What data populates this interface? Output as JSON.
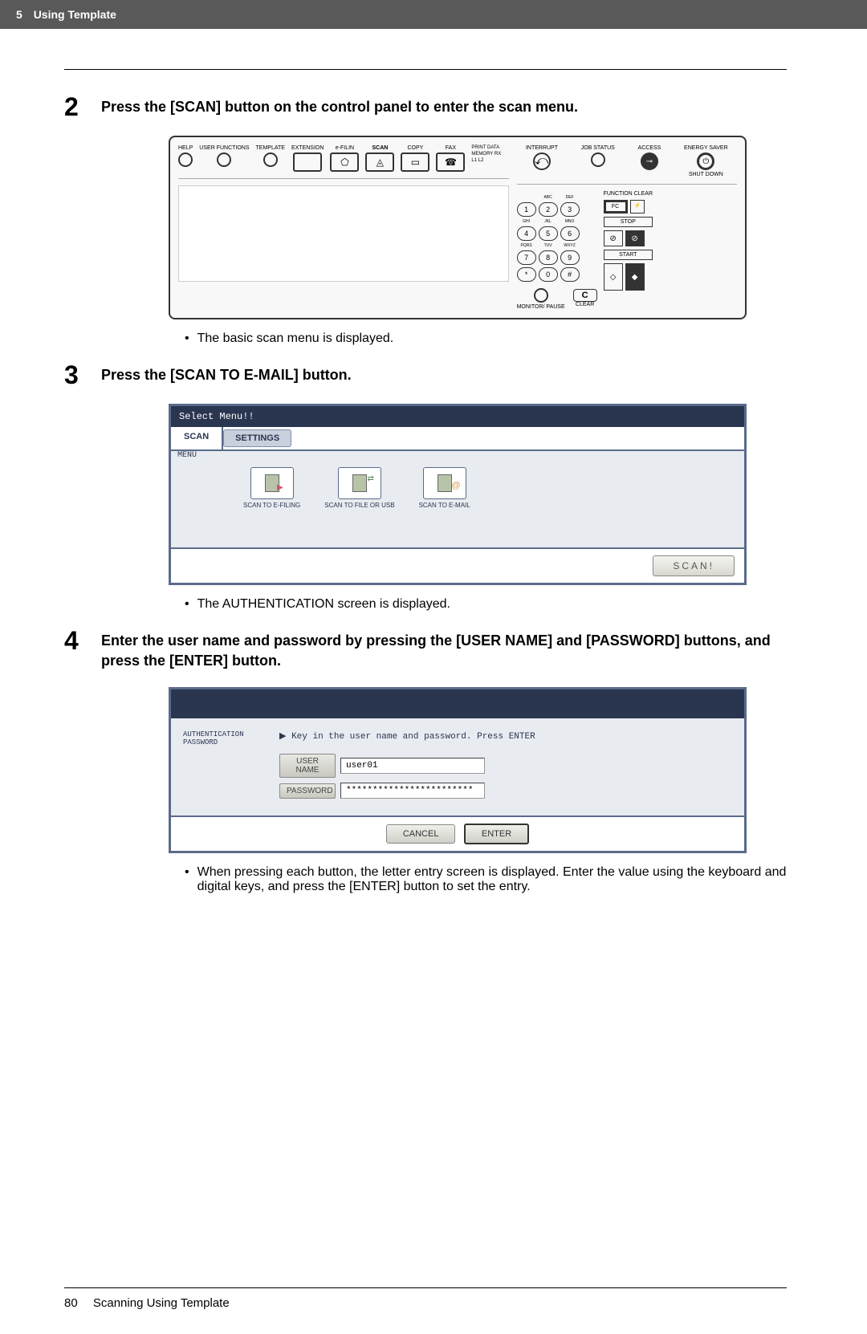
{
  "header": {
    "chapter_num": "5",
    "chapter_title": "Using Template"
  },
  "step2": {
    "num": "2",
    "text": "Press the [SCAN] button on the control panel to enter the scan menu.",
    "bullet": "The basic scan menu is displayed."
  },
  "control_panel": {
    "help": "HELP",
    "user_functions": "USER FUNCTIONS",
    "template": "TEMPLATE",
    "extension": "EXTENSION",
    "efiling": "e-FILIN",
    "scan": "SCAN",
    "copy": "COPY",
    "fax": "FAX",
    "print_data": "PRINT DATA",
    "memory_rx": "MEMORY RX",
    "l1l2": "L1   L2",
    "interrupt": "INTERRUPT",
    "job_status": "JOB STATUS",
    "access": "ACCESS",
    "energy_saver": "ENERGY SAVER",
    "shut_down": "SHUT DOWN",
    "function_clear": "FUNCTION CLEAR",
    "fc": "FC",
    "stop": "STOP",
    "start": "START",
    "monitor_pause": "MONITOR/ PAUSE",
    "clear_c": "C",
    "clear": "CLEAR",
    "keypad": [
      "1",
      "2",
      "3",
      "4",
      "5",
      "6",
      "7",
      "8",
      "9",
      "*",
      "0",
      "#"
    ],
    "keypad_sup": [
      "",
      "ABC",
      "DEF",
      "GHI",
      "JKL",
      "MNO",
      "PQRS",
      "TUV",
      "WXYZ",
      "",
      "",
      ""
    ]
  },
  "step3": {
    "num": "3",
    "text": "Press the [SCAN TO E-MAIL] button.",
    "bullet": "The AUTHENTICATION screen is displayed."
  },
  "scan_menu": {
    "title": "Select Menu!!",
    "tab_scan": "SCAN",
    "tab_settings": "SETTINGS",
    "left_label": "MENU",
    "opt_efiling": "SCAN TO E-FILING",
    "opt_file": "SCAN TO FILE OR USB",
    "opt_email": "SCAN TO E-MAIL",
    "scan_btn": "SCAN!"
  },
  "step4": {
    "num": "4",
    "text": "Enter the user name and password by pressing the [USER NAME] and [PASSWORD] buttons, and press the [ENTER] button.",
    "bullet": "When pressing each button, the letter entry screen is displayed.  Enter the value using the keyboard and digital keys, and press the [ENTER] button to set the entry."
  },
  "auth": {
    "side": "AUTHENTICATION PASSWORD",
    "prompt": "Key in the user name and password. Press ENTER",
    "user_name_label": "USER NAME",
    "user_name_value": "user01",
    "password_label": "PASSWORD",
    "password_value": "************************",
    "cancel": "CANCEL",
    "enter": "ENTER"
  },
  "footer": {
    "page": "80",
    "title": "Scanning Using Template"
  }
}
